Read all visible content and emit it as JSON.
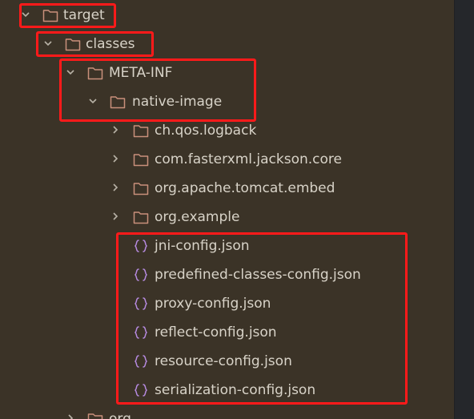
{
  "tree": {
    "target": "target",
    "classes": "classes",
    "meta_inf": "META-INF",
    "native_image": "native-image",
    "folders": [
      "ch.qos.logback",
      "com.fasterxml.jackson.core",
      "org.apache.tomcat.embed",
      "org.example"
    ],
    "files": [
      "jni-config.json",
      "predefined-classes-config.json",
      "proxy-config.json",
      "reflect-config.json",
      "resource-config.json",
      "serialization-config.json"
    ],
    "partial_folder": "org"
  },
  "colors": {
    "background": "#3b3327",
    "text": "#d8d3c8",
    "folder_icon": "#c9907b",
    "json_icon": "#b68ae0",
    "highlight": "#ff1a1a"
  },
  "icons": {
    "expanded": "chevron-down-icon",
    "collapsed": "chevron-right-icon",
    "folder": "folder-icon",
    "json_file": "json-file-icon"
  }
}
